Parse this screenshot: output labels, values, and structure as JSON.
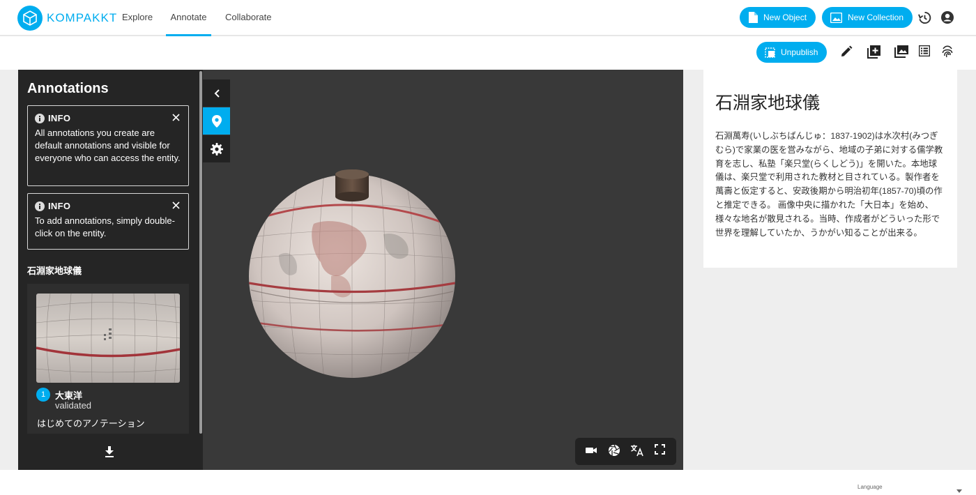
{
  "app": {
    "name": "KOMPAKKT",
    "accent": "#00adef"
  },
  "nav": {
    "explore": "Explore",
    "annotate": "Annotate",
    "collaborate": "Collaborate"
  },
  "header_actions": {
    "new_object": "New Object",
    "new_collection": "New Collection"
  },
  "toolbar": {
    "unpublish": "Unpublish"
  },
  "sidebar": {
    "title": "Annotations",
    "info1": {
      "head": "INFO",
      "body": "All annotations you create are default annotations and visible for everyone who can access the entity."
    },
    "info2": {
      "head": "INFO",
      "body": "To add annotations, simply double-click on the entity."
    },
    "entity_title": "石淵家地球儀",
    "annotation": {
      "number": "1",
      "title": "大東洋",
      "status": "validated",
      "description": "はじめてのアノテーション"
    }
  },
  "entity": {
    "title": "石淵家地球儀",
    "description": "石淵萬寿(いしぶちばんじゅ：1837-1902)は水次村(みつぎむら)で家業の医を営みながら、地域の子弟に対する儒学教育を志し、私塾「楽只堂(らくしどう)」を開いた。本地球儀は、楽只堂で利用された教材と目されている。製作者を萬壽と仮定すると、安政後期から明治初年(1857-70)頃の作と推定できる。 画像中央に描かれた「大日本」を始め、様々な地名が散見される。当時、作成者がどういった形で世界を理解していたか、うかがい知ることが出来る。"
  },
  "footer": {
    "language_label": "Language"
  }
}
